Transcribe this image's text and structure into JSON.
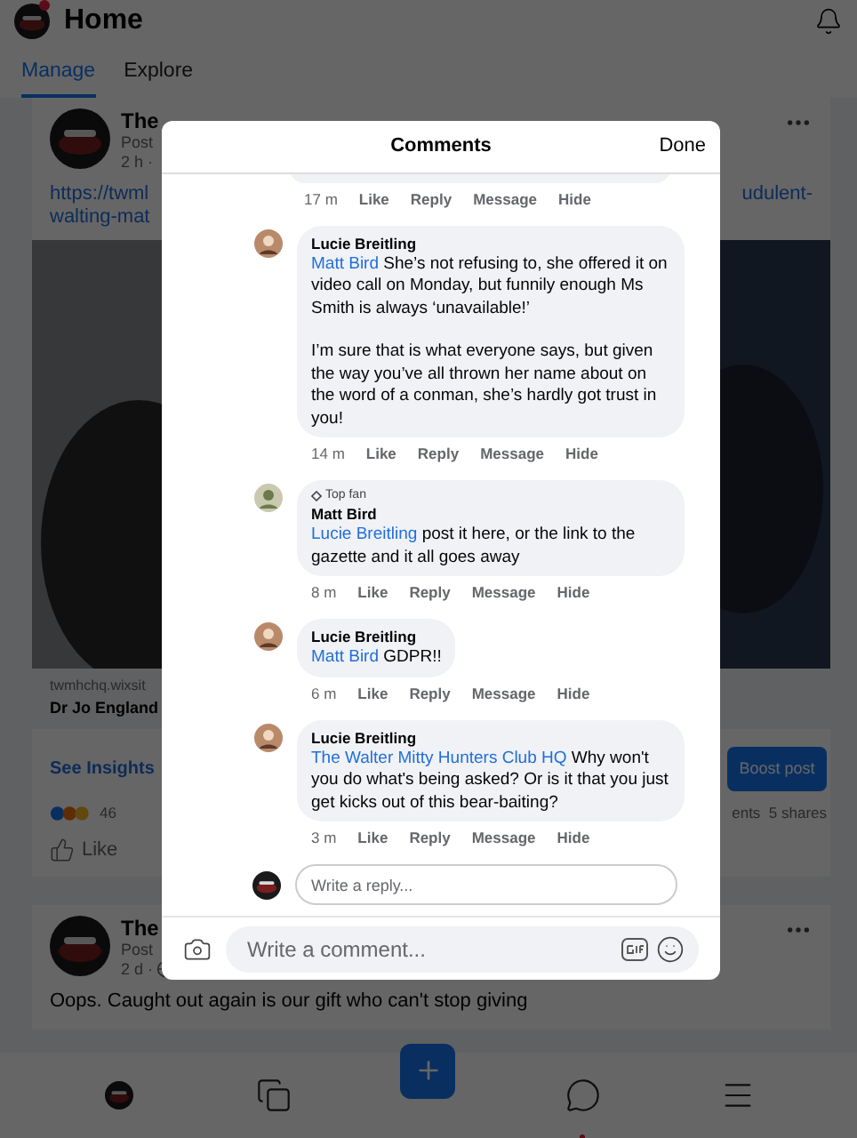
{
  "header": {
    "title": "Home",
    "has_notification": true
  },
  "tabs": [
    {
      "label": "Manage",
      "selected": true
    },
    {
      "label": "Explore",
      "selected": false
    }
  ],
  "post": {
    "author": "The",
    "posted": "Post",
    "time": "2 h ·",
    "link_left": "https://twml",
    "link_left_2": "walting-mat",
    "link_right": "udulent-",
    "site": "twmhchq.wixsit",
    "link_title": "Dr Jo England",
    "insights": "See Insights",
    "boost": "Boost post",
    "reaction_count": "46",
    "stats": "ents  5 shares",
    "like": "Like"
  },
  "post2": {
    "author": "The",
    "posted": "Post",
    "time": "2 d ·",
    "text": "Oops. Caught out again is our gift who can't stop giving"
  },
  "comments_modal": {
    "title": "Comments",
    "done": "Done",
    "comments": [
      {
        "kind": "partial",
        "time": "17 m",
        "actions": [
          "Like",
          "Reply",
          "Message",
          "Hide"
        ]
      },
      {
        "kind": "full",
        "author": "Lucie Breitling",
        "mention": "Matt Bird",
        "paragraphs": [
          "She’s not refusing to, she offered it on video call on Monday, but funnily enough Ms Smith is always ‘unavailable!’",
          "I’m sure that is what everyone says, but given the way you’ve all thrown her name about on the word of a conman, she’s hardly got trust in you!"
        ],
        "time": "14 m",
        "actions": [
          "Like",
          "Reply",
          "Message",
          "Hide"
        ]
      },
      {
        "kind": "full",
        "author": "Matt Bird",
        "badge": "Top fan",
        "mention": "Lucie Breitling",
        "paragraphs": [
          "post it here, or the link to the gazette and it all goes away"
        ],
        "time": "8 m",
        "actions": [
          "Like",
          "Reply",
          "Message",
          "Hide"
        ]
      },
      {
        "kind": "full",
        "author": "Lucie Breitling",
        "mention": "Matt Bird",
        "paragraphs": [
          "GDPR!!"
        ],
        "time": "6 m",
        "actions": [
          "Like",
          "Reply",
          "Message",
          "Hide"
        ]
      },
      {
        "kind": "full",
        "author": "Lucie Breitling",
        "mention": "The Walter Mitty Hunters Club HQ",
        "paragraphs": [
          "Why won't you do what's being asked? Or is it that you just get kicks out of this bear-baiting?"
        ],
        "time": "3 m",
        "actions": [
          "Like",
          "Reply",
          "Message",
          "Hide"
        ]
      }
    ],
    "reply_placeholder": "Write a reply...",
    "comment_placeholder": "Write a comment..."
  },
  "bottom_nav": [
    {
      "kind": "avatar"
    },
    {
      "kind": "pages"
    },
    {
      "kind": "create"
    },
    {
      "kind": "messages",
      "has_notification": true
    },
    {
      "kind": "menu"
    }
  ]
}
